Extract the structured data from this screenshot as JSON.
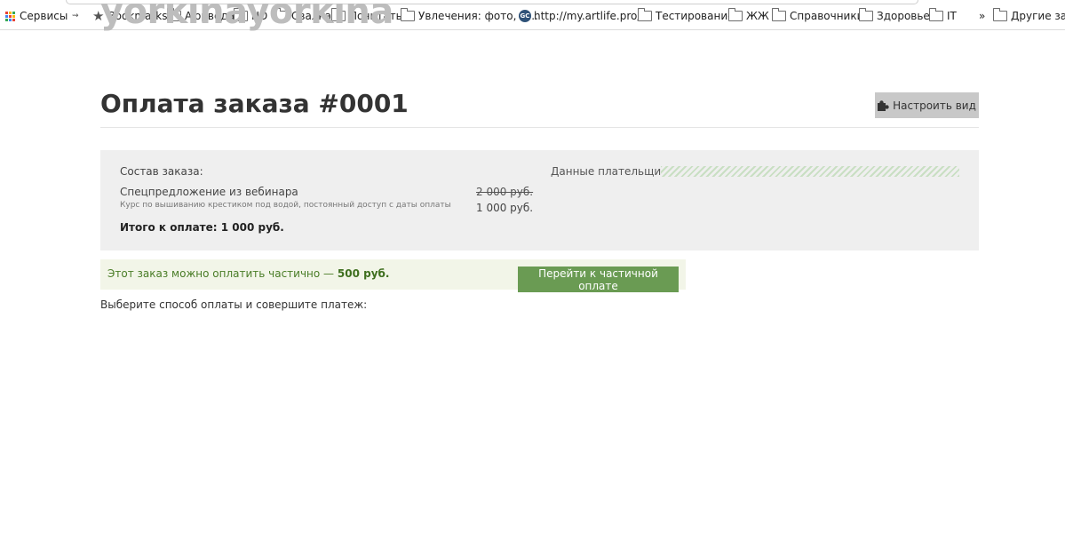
{
  "bookmarks": {
    "items": [
      {
        "label": "Сервисы",
        "icon": "apps-icon"
      },
      {
        "label": "",
        "icon": "small-icon"
      },
      {
        "label": "Bookmarks",
        "icon": "star-icon"
      },
      {
        "label": "Аюрведа",
        "icon": "folder-icon"
      },
      {
        "label": "HD",
        "icon": "folder-icon"
      },
      {
        "label": "Свалка",
        "icon": "folder-icon"
      },
      {
        "label": "Почитать",
        "icon": "folder-icon"
      },
      {
        "label": "Увлечения: фото, G...",
        "icon": "folder-icon"
      },
      {
        "label": "http://my.artlife.pro/...",
        "icon": "gc-icon"
      },
      {
        "label": "Тестирование",
        "icon": "folder-icon"
      },
      {
        "label": "ЖЖ",
        "icon": "folder-icon"
      },
      {
        "label": "Справочники",
        "icon": "folder-icon"
      },
      {
        "label": "Здоровье",
        "icon": "folder-icon"
      },
      {
        "label": "IT",
        "icon": "folder-icon"
      }
    ],
    "overflow_label": "»",
    "other_label": "Другие закл"
  },
  "logo_text": "yorkinayorkina",
  "page": {
    "title": "Оплата заказа #0001",
    "config_button": "Настроить вид"
  },
  "order": {
    "composition_label": "Состав заказа:",
    "item_name": "Спецпредложение из вебинара",
    "item_desc": "Курс по вышиванию крестиком под водой, постоянный доступ с даты оплаты",
    "old_price": "2 000 руб.",
    "new_price": "1 000 руб.",
    "total": "Итого к оплате: 1 000 руб.",
    "payer_label": "Данные плательщика:"
  },
  "partial": {
    "text": "Этот заказ можно оплатить частично —",
    "amount": "500 руб.",
    "button": "Перейти к частичной оплате"
  },
  "choose_text": "Выберите способ оплаты и совершите платеж:",
  "colors": {
    "accent_green": "#6a9b53",
    "partial_bg": "#f2f5e8",
    "panel_bg": "#efefef",
    "config_btn_bg": "#c8c8c8"
  }
}
